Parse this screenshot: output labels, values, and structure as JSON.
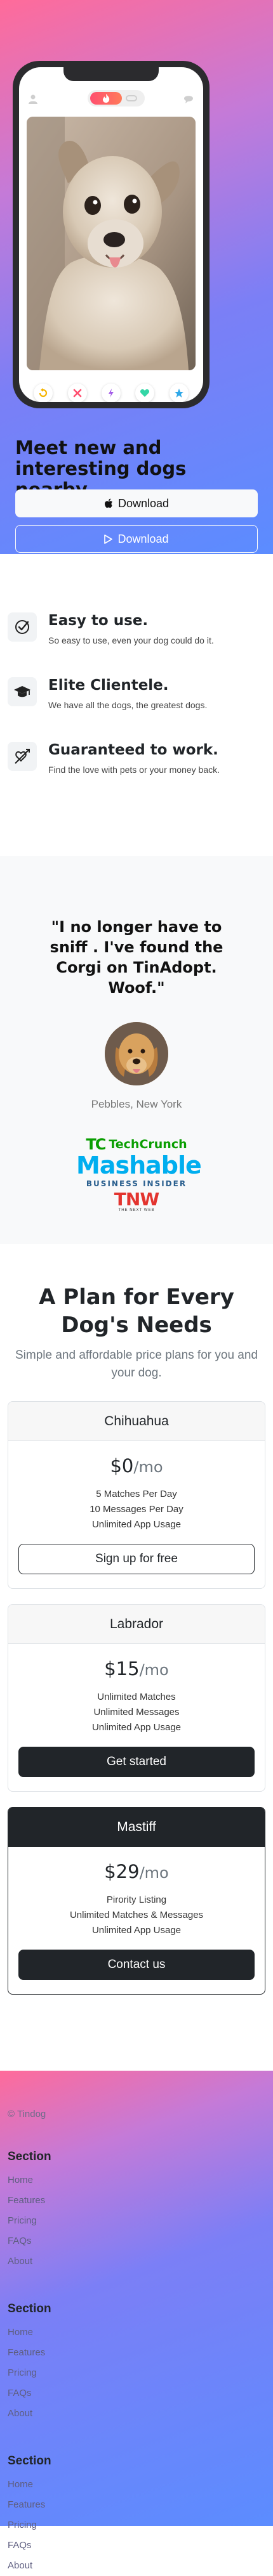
{
  "hero": {
    "title": "Meet new and interesting dogs nearby.",
    "download_apple_label": "Download",
    "download_play_label": "Download",
    "app_actions": [
      "rewind-icon",
      "nope-icon",
      "boost-icon",
      "like-icon",
      "superlike-icon"
    ]
  },
  "features": [
    {
      "title": "Easy to use.",
      "text": "So easy to use, even your dog could do it.",
      "icon": "check-circle-icon"
    },
    {
      "title": "Elite Clientele.",
      "text": "We have all the dogs, the greatest dogs.",
      "icon": "graduation-cap-icon"
    },
    {
      "title": "Guaranteed to work.",
      "text": "Find the love with pets or your money back.",
      "icon": "heart-arrow-icon"
    }
  ],
  "testimonial": {
    "quote": "\"I no longer have to sniff . I've found the Corgi on TinAdopt. Woof.\"",
    "author": "Pebbles, New York",
    "press": {
      "techcrunch_mark": "TC",
      "techcrunch": "TechCrunch",
      "mashable": "Mashable",
      "business_insider": "BUSINESS INSIDER",
      "tnw": "TNW",
      "tnw_sub": "THE NEXT WEB"
    }
  },
  "pricing": {
    "title": "A Plan for Every Dog's Needs",
    "subtitle": "Simple and affordable price plans for you and your dog.",
    "plans": [
      {
        "name": "Chihuahua",
        "price": "$0",
        "period": "/mo",
        "features": [
          "5 Matches Per Day",
          "10 Messages Per Day",
          "Unlimited App Usage"
        ],
        "button": "Sign up for free"
      },
      {
        "name": "Labrador",
        "price": "$15",
        "period": "/mo",
        "features": [
          "Unlimited Matches",
          "Unlimited Messages",
          "Unlimited App Usage"
        ],
        "button": "Get started"
      },
      {
        "name": "Mastiff",
        "price": "$29",
        "period": "/mo",
        "features": [
          "Pirority Listing",
          "Unlimited Matches & Messages",
          "Unlimited App Usage"
        ],
        "button": "Contact us"
      }
    ]
  },
  "footer": {
    "copyright": "© Tindog",
    "sections": [
      {
        "heading": "Section",
        "links": [
          "Home",
          "Features",
          "Pricing",
          "FAQs",
          "About"
        ]
      },
      {
        "heading": "Section",
        "links": [
          "Home",
          "Features",
          "Pricing",
          "FAQs",
          "About"
        ]
      },
      {
        "heading": "Section",
        "links": [
          "Home",
          "Features",
          "Pricing",
          "FAQs",
          "About"
        ]
      }
    ]
  },
  "colors": {
    "gradient_pink": "#ff6b9a",
    "gradient_blue": "#5b8cff",
    "dark": "#212529",
    "tinder_red": "#ff4f6f"
  }
}
